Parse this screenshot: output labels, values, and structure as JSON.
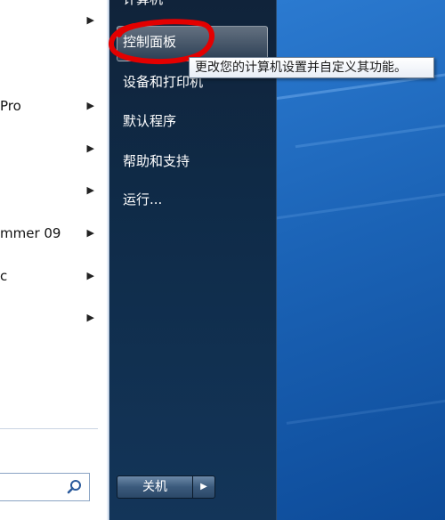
{
  "left_panel": {
    "items": [
      {
        "label": "",
        "has_arrow": true
      },
      {
        "label": "Pro",
        "has_arrow": true
      },
      {
        "label": "",
        "has_arrow": true
      },
      {
        "label": "",
        "has_arrow": true
      },
      {
        "label": "mmer 09",
        "has_arrow": true
      },
      {
        "label": "c",
        "has_arrow": true
      },
      {
        "label": "",
        "has_arrow": true
      }
    ],
    "arrow_glyph": "▶",
    "search": {
      "value": "",
      "icon": "search-icon"
    }
  },
  "right_panel": {
    "items": [
      {
        "label": "计算机"
      },
      {
        "label": "控制面板"
      },
      {
        "label": "设备和打印机"
      },
      {
        "label": "默认程序"
      },
      {
        "label": "帮助和支持"
      },
      {
        "label": "运行..."
      }
    ],
    "shutdown": {
      "label": "关机",
      "arrow_glyph": "▶"
    }
  },
  "tooltip": {
    "text": "更改您的计算机设置并自定义其功能。"
  },
  "annotation": {
    "color": "#e30000"
  }
}
